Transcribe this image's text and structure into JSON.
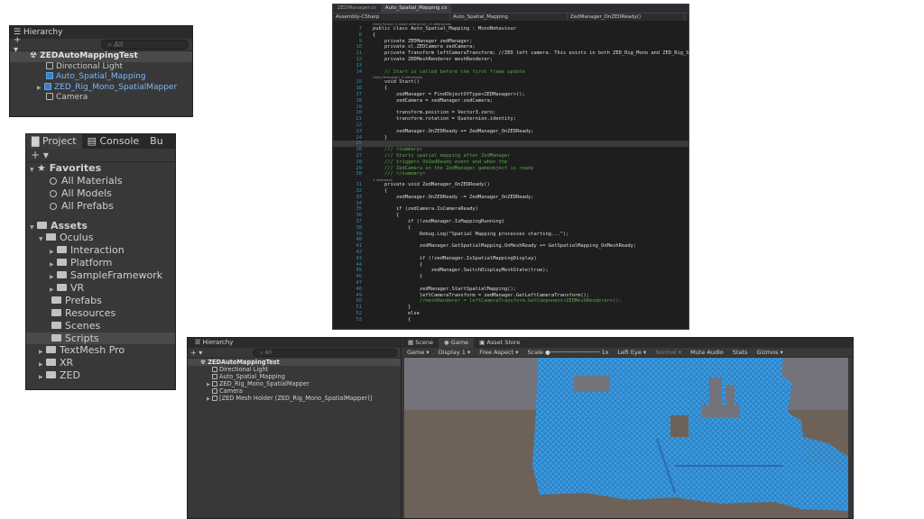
{
  "hierarchy_top": {
    "title": "Hierarchy",
    "add": "+ ▾",
    "search_placeholder": "All",
    "scene": "ZEDAutoMappingTest",
    "items": [
      {
        "label": "Directional Light"
      },
      {
        "label": "Auto_Spatial_Mapping"
      },
      {
        "label": "ZED_Rig_Mono_SpatialMapper"
      },
      {
        "label": "Camera"
      }
    ]
  },
  "project": {
    "tabs": [
      "Project",
      "Console",
      "Bu"
    ],
    "add": "+ ▾",
    "favorites": "Favorites",
    "favorite_items": [
      "All Materials",
      "All Models",
      "All Prefabs"
    ],
    "assets": "Assets",
    "oculus": "Oculus",
    "oculus_items": [
      "Interaction",
      "Platform",
      "SampleFramework",
      "VR"
    ],
    "asset_items": [
      "Prefabs",
      "Resources",
      "Scenes",
      "Scripts"
    ],
    "root_items": [
      "TextMesh Pro",
      "XR",
      "ZED"
    ]
  },
  "code": {
    "file_tabs": [
      "ZEDManager.cs",
      "Auto_Spatial_Mapping.cs"
    ],
    "nav": [
      "Assembly-CSharp",
      "Auto_Spatial_Mapping",
      "ZedManager_OnZEDReady()"
    ],
    "hints": {
      "class_refs": "Unity Script (1 asset reference) | 0 references",
      "start_refs": "Unity Message | 0 references",
      "handler_refs": "1 reference"
    },
    "lines": [
      {
        "n": "7",
        "t": "public class Auto_Spatial_Mapping : MonoBehaviour"
      },
      {
        "n": "8",
        "t": "{"
      },
      {
        "n": "9",
        "t": "    private ZEDManager zedManager;"
      },
      {
        "n": "10",
        "t": "    private sl.ZEDCamera zedCamera;"
      },
      {
        "n": "11",
        "t": "    private Transform leftCameraTransform; //ZED left camera. This exists in both ZED_Rig_Mono and ZED_Rig_Stereo."
      },
      {
        "n": "12",
        "t": "    private ZEDMeshRenderer meshRenderer;"
      },
      {
        "n": "13",
        "t": ""
      },
      {
        "n": "14",
        "t": "    // Start is called before the first frame update"
      },
      {
        "n": "15",
        "t": "    void Start()"
      },
      {
        "n": "16",
        "t": "    {"
      },
      {
        "n": "17",
        "t": "        zedManager = FindObjectOfType<ZEDManager>();"
      },
      {
        "n": "18",
        "t": "        zedCamera = zedManager.zedCamera;"
      },
      {
        "n": "19",
        "t": ""
      },
      {
        "n": "20",
        "t": "        transform.position = Vector3.zero;"
      },
      {
        "n": "21",
        "t": "        transform.rotation = Quaternion.identity;"
      },
      {
        "n": "22",
        "t": ""
      },
      {
        "n": "23",
        "t": "        zedManager.OnZEDReady += ZedManager_OnZEDReady;"
      },
      {
        "n": "24",
        "t": "    }"
      },
      {
        "n": "25",
        "t": ""
      },
      {
        "n": "26",
        "t": "    /// <summary>"
      },
      {
        "n": "27",
        "t": "    /// Starts spatial mapping after ZedManager"
      },
      {
        "n": "28",
        "t": "    /// triggers OnZedReady event and when the"
      },
      {
        "n": "29",
        "t": "    /// ZedCamera on the ZedManager gameobject is ready"
      },
      {
        "n": "30",
        "t": "    /// </summary>"
      },
      {
        "n": "31",
        "t": "    private void ZedManager_OnZEDReady()"
      },
      {
        "n": "32",
        "t": "    {"
      },
      {
        "n": "33",
        "t": "        zedManager.OnZEDReady -= ZedManager_OnZEDReady;"
      },
      {
        "n": "34",
        "t": ""
      },
      {
        "n": "35",
        "t": "        if (zedCamera.IsCameraReady)"
      },
      {
        "n": "36",
        "t": "        {"
      },
      {
        "n": "37",
        "t": "            if (!zedManager.IsMappingRunning)"
      },
      {
        "n": "38",
        "t": "            {"
      },
      {
        "n": "39",
        "t": "                Debug.Log(\"Spatial Mapping processes starting...\");"
      },
      {
        "n": "40",
        "t": ""
      },
      {
        "n": "41",
        "t": "                zedManager.GetSpatialMapping.OnMeshReady += GetSpatialMapping_OnMeshReady;"
      },
      {
        "n": "42",
        "t": ""
      },
      {
        "n": "43",
        "t": "                if (!zedManager.IsSpatialMappingDisplay)"
      },
      {
        "n": "44",
        "t": "                {"
      },
      {
        "n": "45",
        "t": "                    zedManager.SwitchDisplayMeshState(true);"
      },
      {
        "n": "46",
        "t": "                }"
      },
      {
        "n": "47",
        "t": ""
      },
      {
        "n": "48",
        "t": "                zedManager.StartSpatialMapping();"
      },
      {
        "n": "49",
        "t": "                leftCameraTransform = zedManager.GetLeftCameraTransform();"
      },
      {
        "n": "50",
        "t": "                //meshRenderer = leftCameraTransform.GetComponent<ZEDMeshRenderer>();"
      },
      {
        "n": "51",
        "t": "            }"
      },
      {
        "n": "52",
        "t": "            else"
      },
      {
        "n": "53",
        "t": "            {"
      }
    ]
  },
  "hierarchy_bottom": {
    "title": "Hierarchy",
    "add": "+ ▾",
    "search_placeholder": "All",
    "scene": "ZEDAutoMappingTest",
    "items": [
      {
        "label": "Directional Light"
      },
      {
        "label": "Auto_Spatial_Mapping"
      },
      {
        "label": "ZED_Rig_Mono_SpatialMapper"
      },
      {
        "label": "Camera"
      },
      {
        "label": "[ZED Mesh Holder (ZED_Rig_Mono_SpatialMapper)]"
      }
    ]
  },
  "game": {
    "tabs": [
      "Scene",
      "Game",
      "Asset Store"
    ],
    "display_mode": "Game",
    "display": "Display 1",
    "aspect": "Free Aspect",
    "scale_label": "Scale",
    "scale_value": "1x",
    "eye": "Left Eye",
    "quality": "Normal",
    "mute": "Mute Audio",
    "stats": "Stats",
    "gizmos": "Gizmos",
    "colors": {
      "mesh": "#3b9de3",
      "sky": "#73737b",
      "ground": "#6e6258"
    }
  }
}
